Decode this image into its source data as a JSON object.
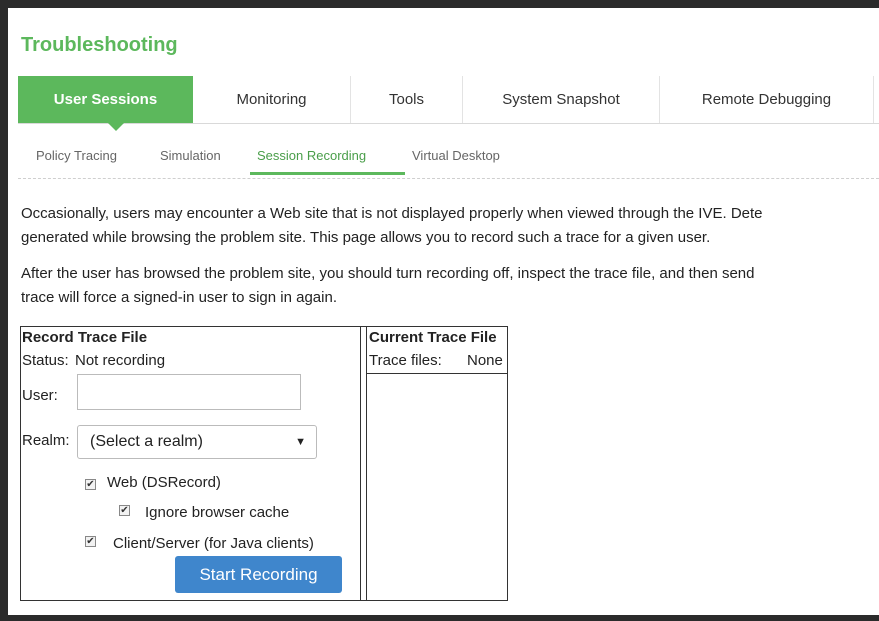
{
  "page": {
    "title": "Troubleshooting"
  },
  "tabs": [
    {
      "label": "User Sessions"
    },
    {
      "label": "Monitoring"
    },
    {
      "label": "Tools"
    },
    {
      "label": "System Snapshot"
    },
    {
      "label": "Remote Debugging"
    }
  ],
  "subtabs": [
    {
      "label": "Policy Tracing"
    },
    {
      "label": "Simulation"
    },
    {
      "label": "Session Recording"
    },
    {
      "label": "Virtual Desktop"
    }
  ],
  "description": {
    "p1_line1": "Occasionally, users may encounter a Web site that is not displayed properly when viewed through the IVE. Dete",
    "p1_line2": "generated while browsing the problem site. This page allows you to record such a trace for a given user.",
    "p2_line1": "After the user has browsed the problem site, you should turn recording off, inspect the trace file, and then send",
    "p2_line2": "trace will force a signed-in user to sign in again."
  },
  "record": {
    "heading": "Record Trace File",
    "status_label": "Status:",
    "status_value": "Not recording",
    "user_label": "User:",
    "user_value": "",
    "realm_label": "Realm:",
    "realm_value": "(Select a realm)",
    "web_label": "Web (DSRecord)",
    "web_checked": true,
    "ignore_cache_label": "Ignore browser cache",
    "ignore_cache_checked": true,
    "client_server_label": "Client/Server (for Java clients)",
    "client_server_checked": true,
    "start_button": "Start Recording"
  },
  "current": {
    "heading": "Current Trace File",
    "files_label": "Trace files:",
    "files_value": "None"
  },
  "colors": {
    "accent": "#5cb85c",
    "button": "#3f86cc"
  }
}
